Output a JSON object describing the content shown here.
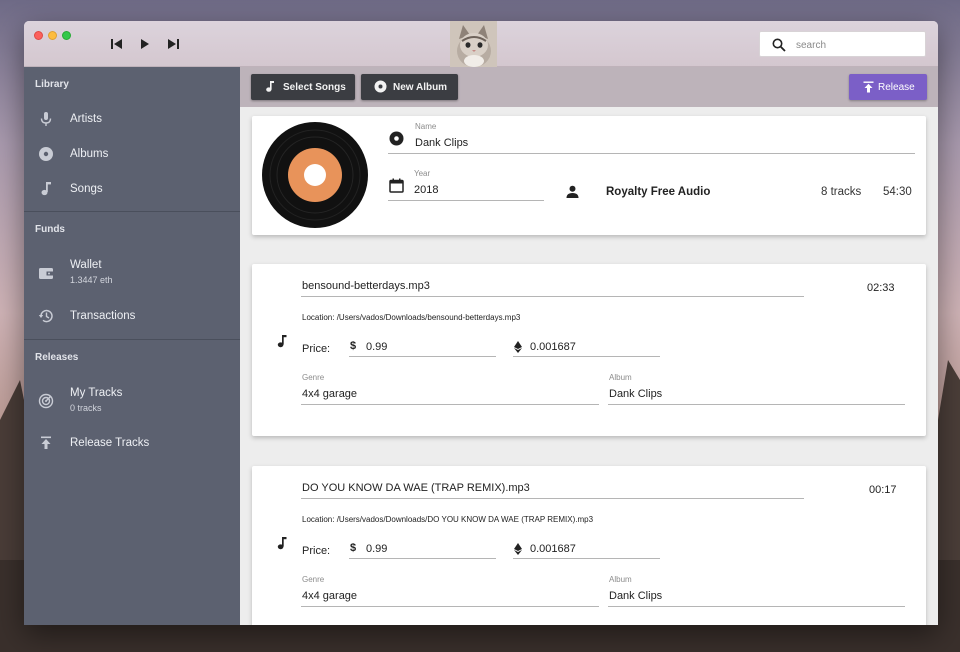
{
  "window": {
    "search_placeholder": "search"
  },
  "sidebar": {
    "sections": [
      {
        "title": "Library"
      },
      {
        "title": "Funds"
      },
      {
        "title": "Releases"
      }
    ],
    "library_items": [
      {
        "label": "Artists",
        "icon": "microphone-icon"
      },
      {
        "label": "Albums",
        "icon": "album-disc-icon"
      },
      {
        "label": "Songs",
        "icon": "music-note-icon"
      }
    ],
    "wallet": {
      "label": "Wallet",
      "sub": "1.3447 eth"
    },
    "transactions": {
      "label": "Transactions"
    },
    "my_tracks": {
      "label": "My Tracks",
      "sub": "0 tracks"
    },
    "release_tracks": {
      "label": "Release Tracks"
    }
  },
  "toolbar": {
    "select_songs": "Select Songs",
    "new_album": "New Album",
    "release": "Release"
  },
  "album": {
    "name_label": "Name",
    "name": "Dank Clips",
    "year_label": "Year",
    "year": "2018",
    "artist": "Royalty Free Audio",
    "track_count": "8 tracks",
    "duration": "54:30",
    "disc_label_color": "#e8935a"
  },
  "tracks": [
    {
      "filename": "bensound-betterdays.mp3",
      "duration": "02:33",
      "location": "Location: /Users/vados/Downloads/bensound-betterdays.mp3",
      "price_label": "Price:",
      "usd_price": "0.99",
      "eth_price": "0.001687",
      "genre_label": "Genre",
      "genre": "4x4 garage",
      "album_label": "Album",
      "album": "Dank Clips"
    },
    {
      "filename": "DO YOU KNOW DA WAE (TRAP REMIX).mp3",
      "duration": "00:17",
      "location": "Location: /Users/vados/Downloads/DO YOU KNOW DA WAE (TRAP REMIX).mp3",
      "price_label": "Price:",
      "usd_price": "0.99",
      "eth_price": "0.001687",
      "genre_label": "Genre",
      "genre": "4x4 garage",
      "album_label": "Album",
      "album": "Dank Clips"
    }
  ],
  "colors": {
    "sidebar": "#5c6170",
    "accent": "#7b5fc7",
    "dark_button": "#3b3d42"
  }
}
